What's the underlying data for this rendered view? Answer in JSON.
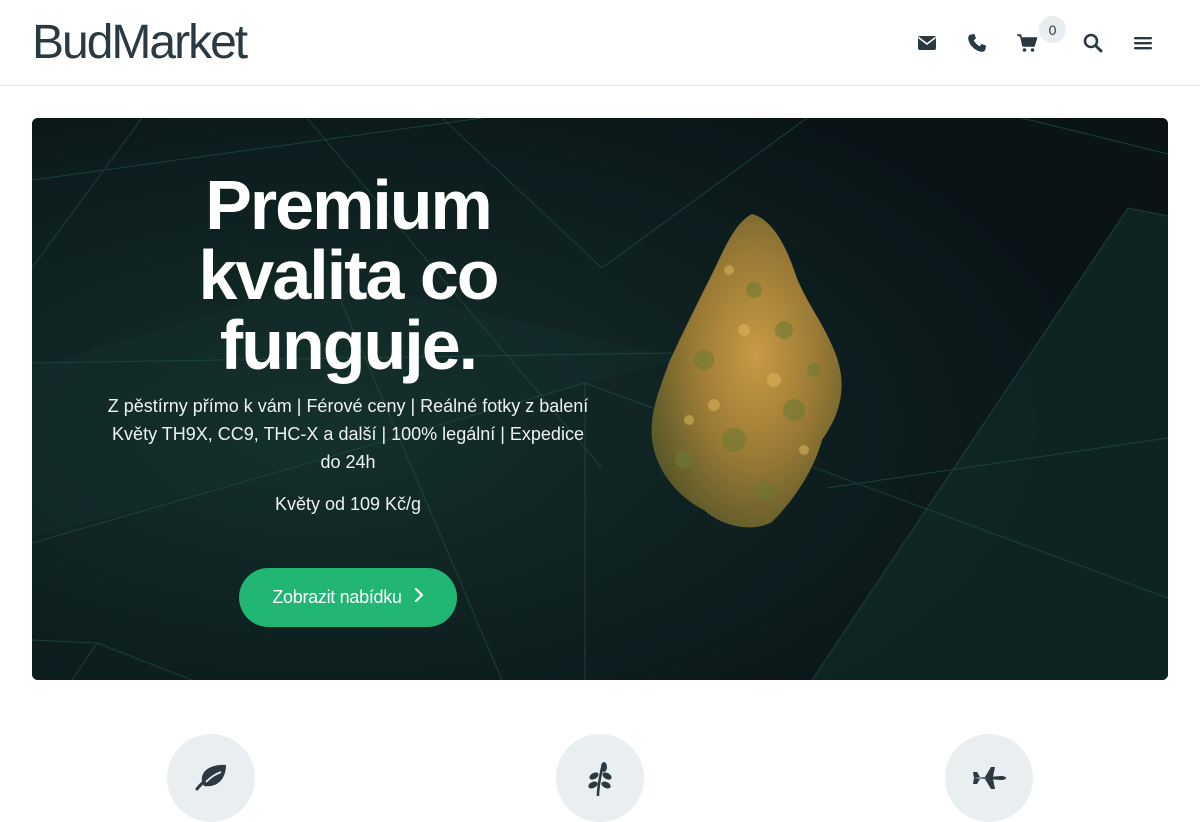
{
  "header": {
    "logo": "BudMarket",
    "icons": {
      "email": "envelope-icon",
      "phone": "phone-icon",
      "cart": "cart-icon",
      "search": "search-icon",
      "menu": "hamburger-menu-icon"
    },
    "cart_count": "0"
  },
  "hero": {
    "title": "Premium kvalita co funguje.",
    "subtitle_line1": "Z pěstírny přímo k vám | Férové ceny | Reálné fotky z balení",
    "subtitle_line2": "Květy TH9X, CC9, THC-X a další | 100% legální | Expedice do 24h",
    "price": "Květy od 109 Kč/g",
    "cta_label": "Zobrazit nabídku",
    "cta_icon": "chevron-right-icon",
    "image": "cannabis-bud-image"
  },
  "features": [
    {
      "icon": "leaf-icon"
    },
    {
      "icon": "plant-sprout-icon"
    },
    {
      "icon": "airplane-icon"
    }
  ],
  "colors": {
    "brand_text": "#2b3a42",
    "accent": "#21b673",
    "hero_bg": "#0a1417",
    "feature_circle": "#e9eef0"
  }
}
